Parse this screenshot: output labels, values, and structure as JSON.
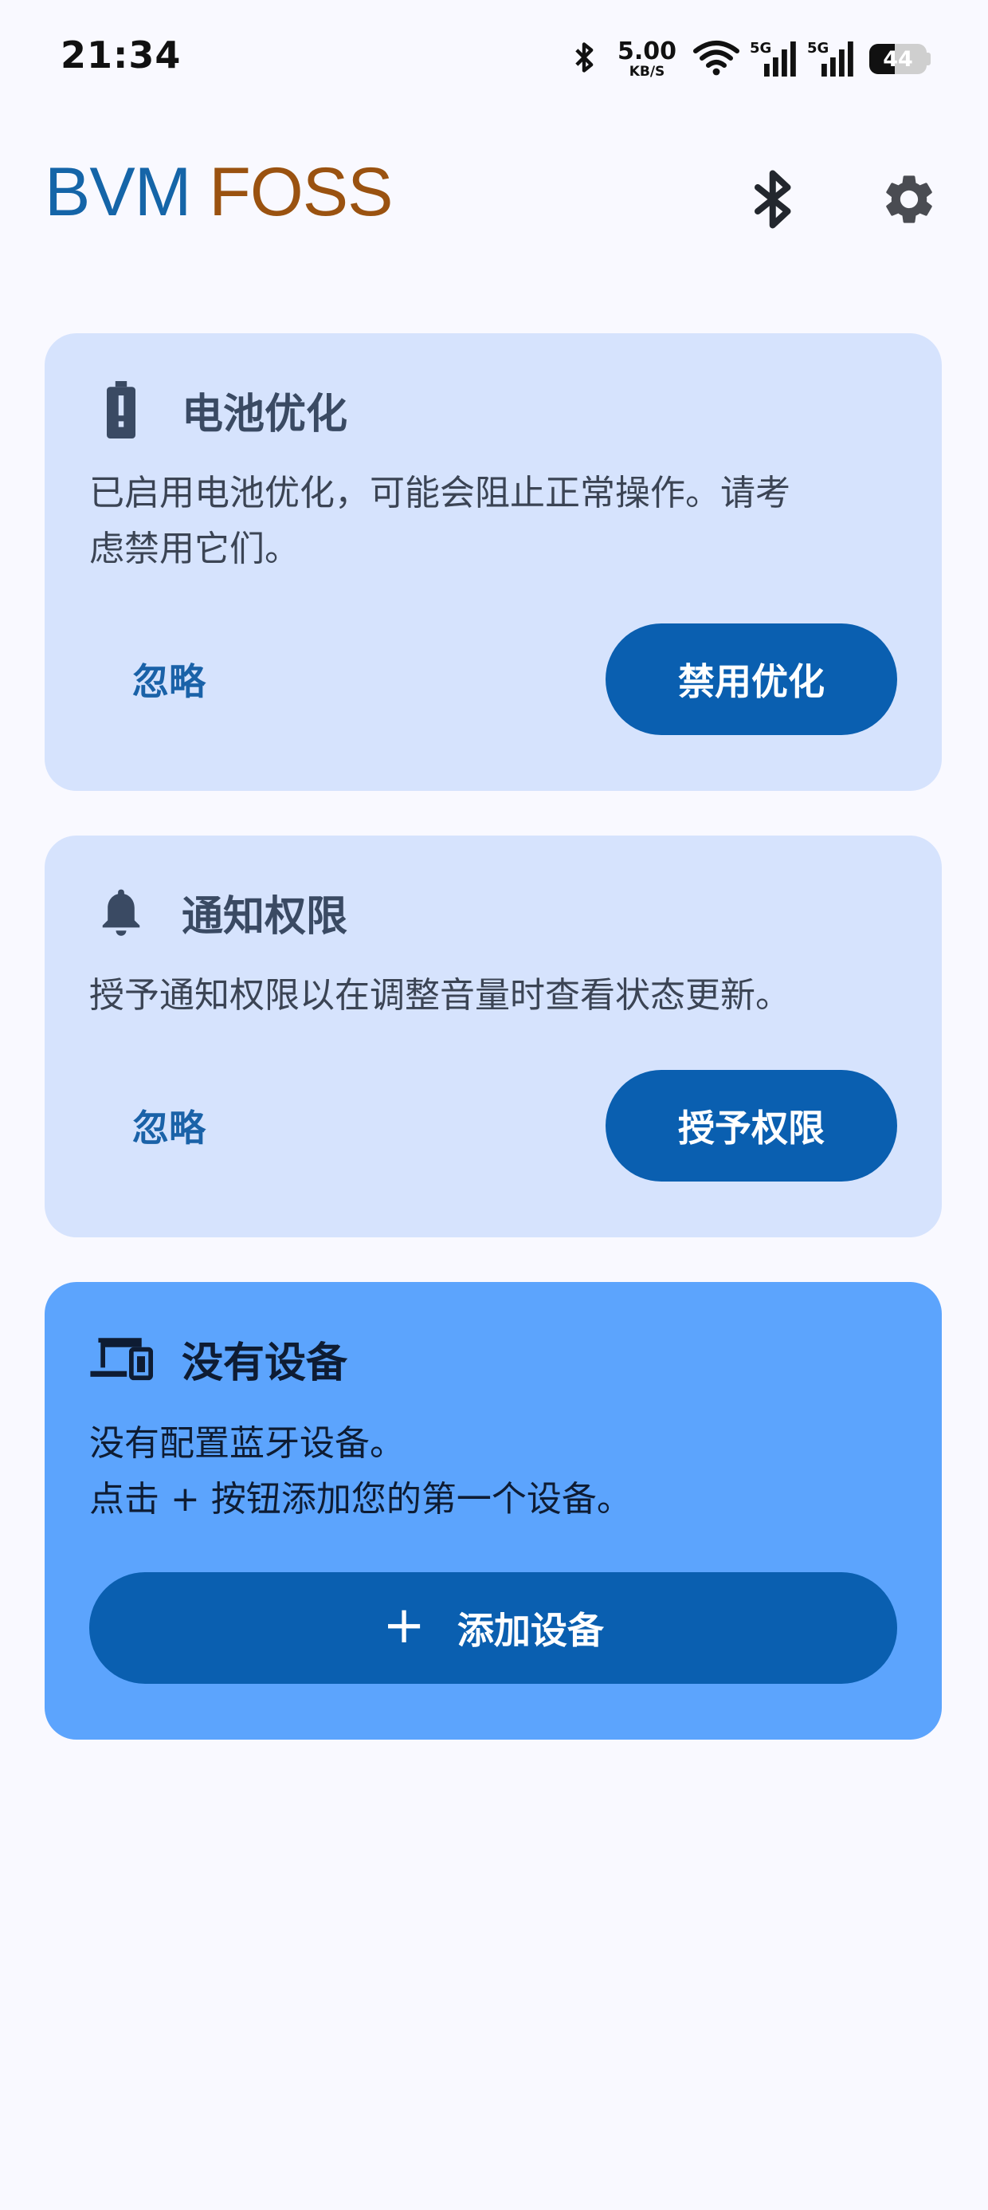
{
  "status_bar": {
    "time": "21:34",
    "speed_value": "5.00",
    "speed_unit": "KB/S",
    "signal_1": "5G",
    "signal_2": "5G",
    "battery_level": "44",
    "icons": [
      "bluetooth-icon",
      "wifi-icon",
      "signal-icon",
      "signal-icon",
      "battery-icon"
    ]
  },
  "app_bar": {
    "title_part1": "BVM",
    "title_part2": "FOSS",
    "colors": {
      "title_part1": "#1565a8",
      "title_part2": "#9a5210"
    },
    "actions": [
      "bluetooth-icon",
      "settings-icon"
    ]
  },
  "cards": {
    "battery": {
      "icon": "battery-alert-icon",
      "title": "电池优化",
      "body": "已启用电池优化，可能会阻止正常操作。请考\n虑禁用它们。",
      "dismiss_label": "忽略",
      "action_label": "禁用优化"
    },
    "notification": {
      "icon": "bell-icon",
      "title": "通知权限",
      "body": "授予通知权限以在调整音量时查看状态更新。",
      "dismiss_label": "忽略",
      "action_label": "授予权限"
    },
    "devices": {
      "icon": "devices-icon",
      "title": "没有设备",
      "body": "没有配置蓝牙设备。\n点击 + 按钮添加您的第一个设备。",
      "plus_symbol": "+",
      "action_label": "添加设备"
    }
  },
  "colors": {
    "background": "#f9f9ff",
    "card_light": "#d6e3fd",
    "card_strong": "#5ca4fd",
    "primary_button": "#0a5fb0",
    "text_button": "#1a62a8"
  }
}
